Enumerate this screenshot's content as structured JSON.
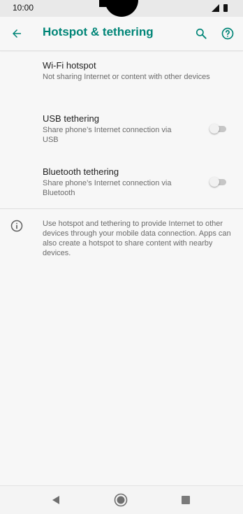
{
  "status_bar": {
    "time": "10:00",
    "icons": [
      "signal-icon",
      "battery-icon"
    ]
  },
  "app_bar": {
    "title": "Hotspot & tethering",
    "icons": [
      "back-arrow-icon",
      "search-icon",
      "help-icon"
    ],
    "accent_color": "#008577"
  },
  "items": [
    {
      "title": "Wi-Fi hotspot",
      "summary": "Not sharing Internet or content with other devices"
    },
    {
      "title": "USB tethering",
      "summary": "Share phone’s Internet connection via USB",
      "toggle_on": false
    },
    {
      "title": "Bluetooth tethering",
      "summary": "Share phone’s Internet connection via Bluetooth",
      "toggle_on": false
    }
  ],
  "info": {
    "icon": "info-icon",
    "text": "Use hotspot and tethering to provide Internet to other devices through your mobile data connection. Apps can also create a hotspot to share content with nearby devices."
  },
  "nav_bar": {
    "icons": [
      "nav-back-icon",
      "nav-home-icon",
      "nav-recents-icon"
    ]
  }
}
